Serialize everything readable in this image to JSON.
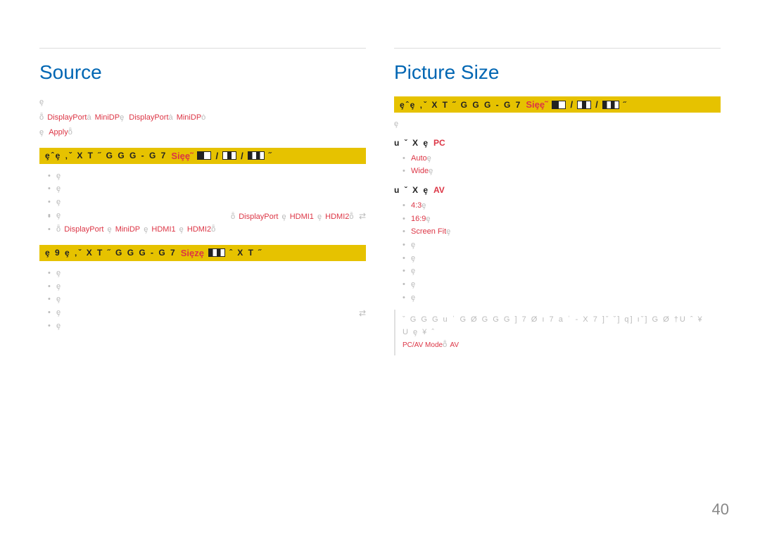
{
  "page_number": "40",
  "left": {
    "heading": "Source",
    "intro1_glyphs": "ȩ",
    "intro2_prefix_glyphs": "ȭ",
    "intro2_red1": "DisplayPort",
    "intro2_mid1": "ȧ",
    "intro2_red2": "MiniDP",
    "intro2_mid2_glyphs": "ȩ                                   ",
    "intro2_red3": "DisplayPort",
    "intro2_mid3": "ȧ",
    "intro2_red4": "MiniDP",
    "intro2_suffix": "ȯ",
    "intro3_prefix_glyphs": "ȩ                                                       ",
    "intro3_red": "Apply",
    "intro3_suffix": "ȭ",
    "yellow1_prefix": "ȩˆȩ   ‚ˇ X    T   ˝   G G   G - G 7",
    "yellow1_red": "Siȩȩ˜",
    "yellow1_icon_sep": " / ",
    "yellow1_suffix": "˝",
    "list1": [
      {
        "glyphs": "ȩ"
      },
      {
        "glyphs": "ȩ"
      },
      {
        "glyphs": "ȩ"
      },
      {
        "glyphs": "ȩ",
        "has_swap": true
      },
      {
        "glyphs_pre": "ȭ",
        "reds": [
          "DisplayPort",
          "HDMI1",
          "HDMI2"
        ],
        "sep": " ȩ",
        "suffix": "ȭ",
        "indent": true
      },
      {
        "glyphs_pre": "ȭ",
        "reds": [
          "DisplayPort",
          "MiniDP",
          "HDMI1",
          "HDMI2"
        ],
        "sep": " ȩ",
        "suffix": "ȭ"
      }
    ],
    "yellow2_prefix": "ȩ 9 ȩ   ‚ˇ X    T   ˝   G G   G - G 7",
    "yellow2_red": "Siȩzȩ",
    "yellow2_mid": "ˆ X    T   ˝",
    "list2": [
      {
        "glyphs": "ȩ"
      },
      {
        "glyphs": "ȩ"
      },
      {
        "glyphs": "ȩ"
      },
      {
        "glyphs": "ȩ",
        "has_swap": true
      },
      {
        "glyphs": "ȩ"
      }
    ]
  },
  "right": {
    "heading": "Picture Size",
    "yellow1_prefix": "ȩˆȩ   ‚ˇ X    T   ˝   G G   G - G 7",
    "yellow1_red": "Siȩȩ˜",
    "yellow1_icon_sep": " / ",
    "yellow1_suffix": "˝",
    "after_yellow_glyphs": "ȩ",
    "section_pc_label": "u ˇ X   ȩ",
    "section_pc_red": "PC",
    "pc_items": [
      {
        "red": "Auto",
        "suffix": "ȩ"
      },
      {
        "red": "Wide",
        "suffix": "ȩ"
      }
    ],
    "section_av_label": "u ˇ X   ȩ",
    "section_av_red": "AV",
    "av_items": [
      {
        "red": "4:3",
        "suffix": "ȩ"
      },
      {
        "red": "16:9",
        "suffix": "ȩ"
      },
      {
        "red": "Screen Fit",
        "suffix": "ȩ"
      }
    ],
    "av_tail": [
      "ȩ",
      "ȩ",
      "ȩ",
      "ȩ",
      "ȩ"
    ],
    "note_line1": "ˇ   G   G G u ˈ G   Ø G G G ] 7 Ø    ı 7 a ˈ    - X 7 ]ˇ    ˇ]  q]  ıˇ] G Ø    †U ˆ ¥ U ȩ ¥  ˆ",
    "note_red": "PC/AV Mode",
    "note_red_trail": "ȭ",
    "note_red2": "AV"
  }
}
